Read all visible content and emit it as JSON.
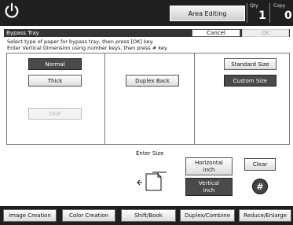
{
  "header": {
    "area_button": "Area Editing",
    "qty_label": "Qty",
    "qty_value": "1",
    "copy_label": "Copy",
    "copy_value": "0"
  },
  "dialog": {
    "title": "Bypass Tray",
    "cancel_label": "Cancel",
    "ok_label": "OK",
    "instruction_1": "Select type of paper for bypass tray, then press [OK] key.",
    "instruction_2": "Enter Vertical Dimension using number keys, then press # key."
  },
  "paper_types": {
    "normal": "Normal",
    "thick": "Thick",
    "ohp": "OHP"
  },
  "duplex_back": "Duplex Back",
  "sizes": {
    "standard": "Standard Size",
    "custom": "Custom Size"
  },
  "enter_size": {
    "label": "Enter Size",
    "horizontal_1": "Horizontal",
    "horizontal_2": "inch",
    "vertical_1": "Vertical",
    "vertical_2": "inch",
    "clear": "Clear",
    "hash": "#"
  },
  "tabs": [
    {
      "label": "Image Creation"
    },
    {
      "label": "Color Creation"
    },
    {
      "label": "Shift/Book"
    },
    {
      "label": "Duplex/Combine"
    },
    {
      "label": "Reduce/Enlarge"
    }
  ],
  "colors": {
    "bar": "#1f1f1f",
    "selected": "#4a4a4a"
  }
}
